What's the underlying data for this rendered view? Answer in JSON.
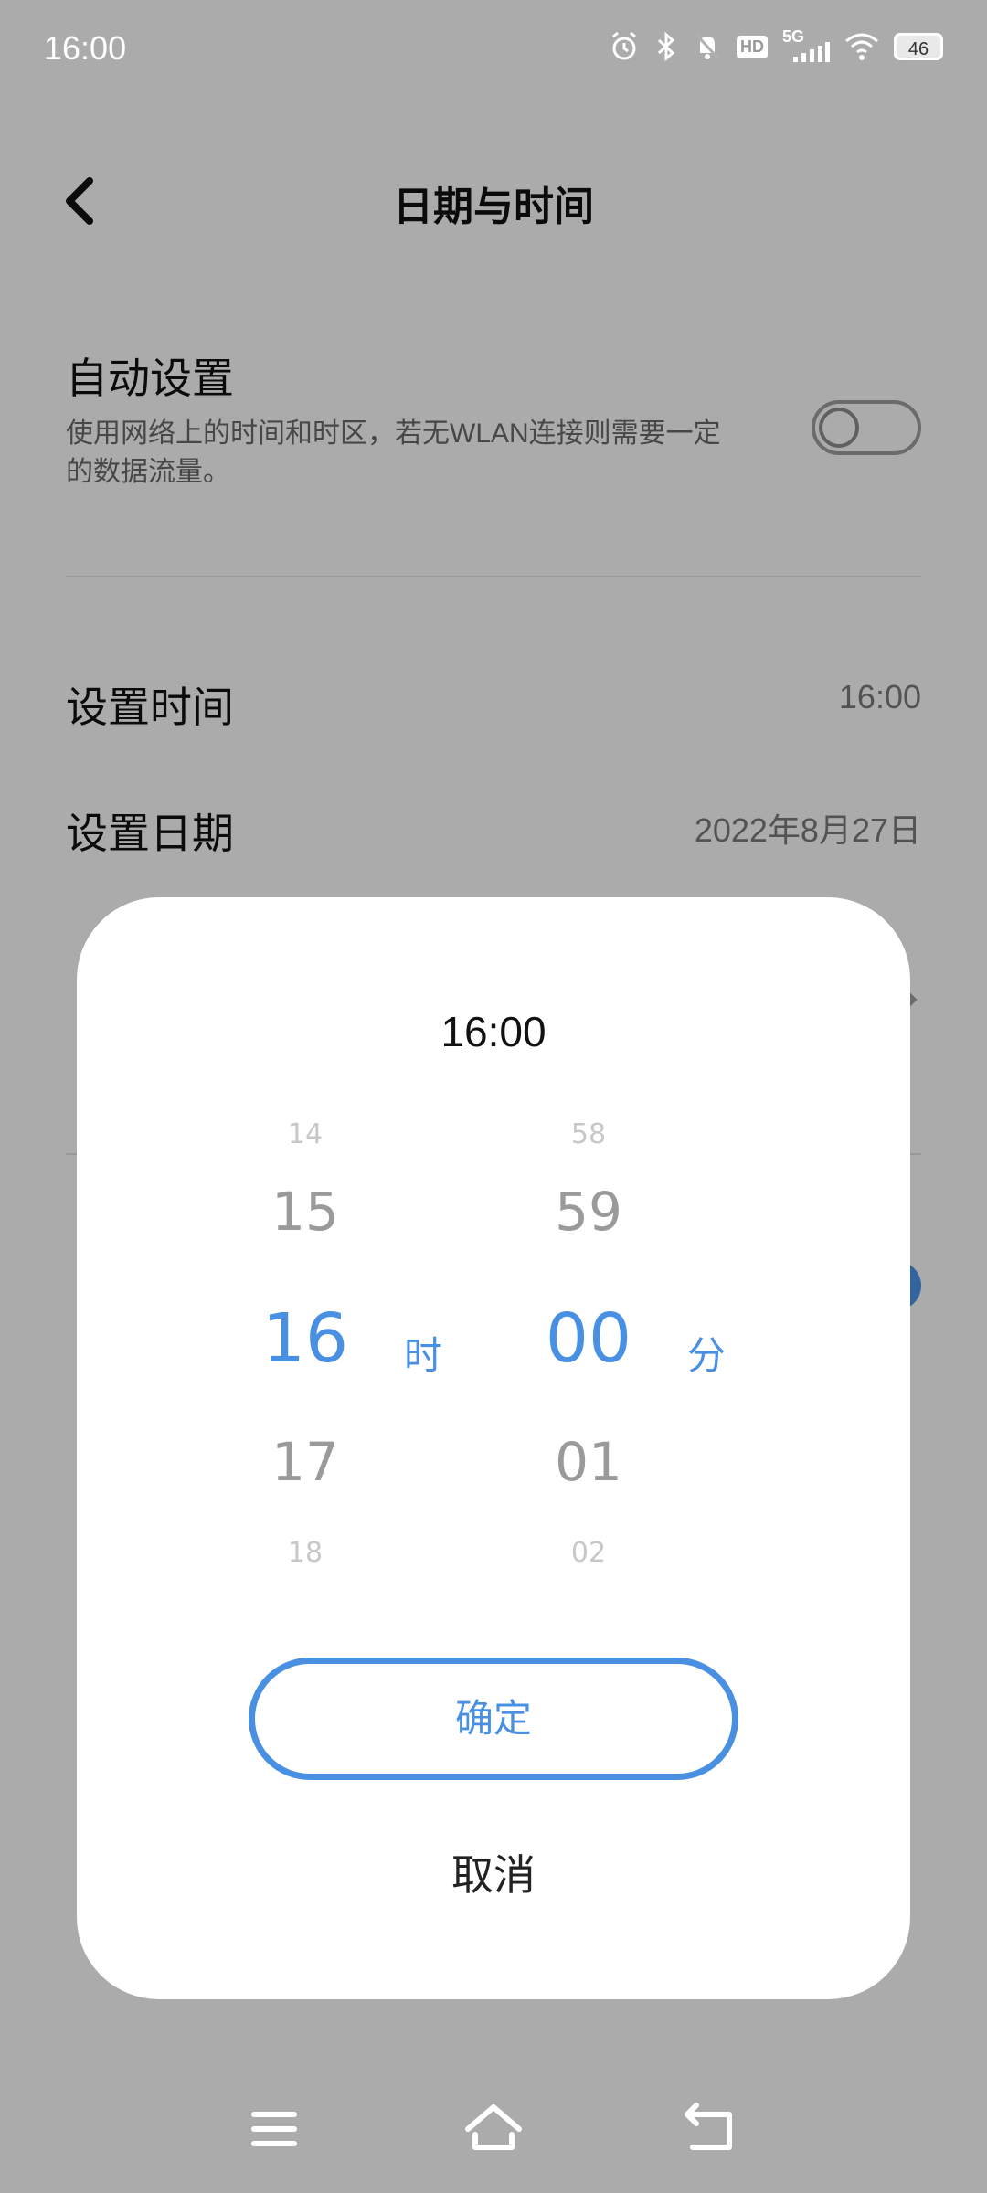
{
  "status_bar": {
    "time": "16:00",
    "battery": "46",
    "network": "5G",
    "hd": "HD",
    "icons": [
      "alarm-icon",
      "bluetooth-icon",
      "mute-icon",
      "hd-icon",
      "signal-icon",
      "wifi-icon",
      "battery-icon"
    ]
  },
  "header": {
    "title": "日期与时间",
    "back_icon": "chevron-left-icon"
  },
  "settings": {
    "auto_set": {
      "title": "自动设置",
      "description": "使用网络上的时间和时区，若无WLAN连接则需要一定的数据流量。",
      "enabled": false
    },
    "set_time": {
      "title": "设置时间",
      "value": "16:00"
    },
    "set_date": {
      "title": "设置日期",
      "value": "2022年8月27日"
    }
  },
  "dialog": {
    "current_time": "16:00",
    "hour_wheel": {
      "items": [
        "14",
        "15",
        "16",
        "17",
        "18"
      ],
      "selected": "16",
      "unit": "时"
    },
    "minute_wheel": {
      "items": [
        "58",
        "59",
        "00",
        "01",
        "02"
      ],
      "selected": "00",
      "unit": "分"
    },
    "confirm_label": "确定",
    "cancel_label": "取消"
  },
  "colors": {
    "accent": "#4a90e2",
    "dim_overlay": "#000000",
    "text_primary": "#111111",
    "text_secondary": "#777777"
  },
  "navbar": {
    "icons": [
      "menu-icon",
      "home-icon",
      "back-icon"
    ]
  }
}
